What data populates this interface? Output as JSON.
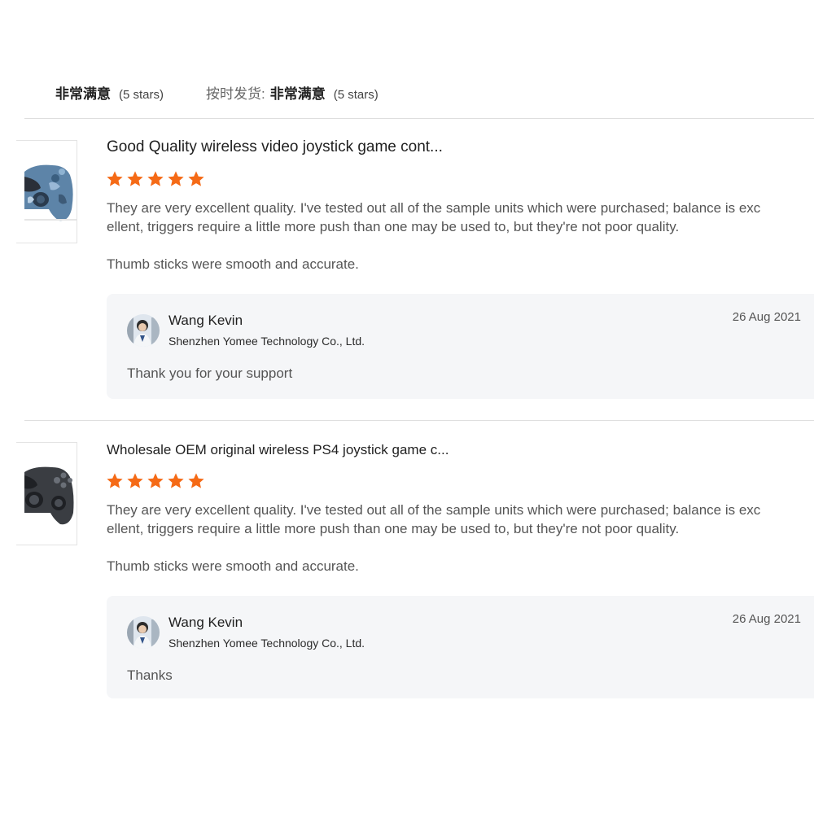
{
  "summary": {
    "rating1_label": "非常满意",
    "rating1_stars": "(5 stars)",
    "rating2_prefix": "按时发货:",
    "rating2_label": "非常满意",
    "rating2_stars": "(5 stars)"
  },
  "colors": {
    "star": "#f56a16",
    "reply_background": "#f5f6f8",
    "divider": "#dedede"
  },
  "reviews": [
    {
      "product_title": "Good Quality wireless video joystick game cont...",
      "product_image": "camo-blue-gamepad-image",
      "rating": 5,
      "paragraph1_line1": "They are very excellent quality. I've tested out all of the sample units which were purchased; balance is exc",
      "paragraph1_line2": "ellent, triggers require a little more push than one may be used to, but they're not poor quality.",
      "paragraph2": "Thumb sticks were smooth and accurate.",
      "reply": {
        "name": "Wang Kevin",
        "company": "Shenzhen Yomee Technology Co., Ltd.",
        "date": "26 Aug 2021",
        "text": "Thank you for your support"
      }
    },
    {
      "product_title": "Wholesale OEM original wireless PS4 joystick game c...",
      "product_image": "black-gamepad-image",
      "rating": 5,
      "paragraph1_line1": "They are very excellent quality. I've tested out all of the sample units which were purchased; balance is exc",
      "paragraph1_line2": "ellent, triggers require a little more push than one may be used to, but they're not poor quality.",
      "paragraph2": "Thumb sticks were smooth and accurate.",
      "reply": {
        "name": "Wang Kevin",
        "company": "Shenzhen Yomee Technology Co., Ltd.",
        "date": "26 Aug 2021",
        "text": "Thanks"
      }
    }
  ]
}
